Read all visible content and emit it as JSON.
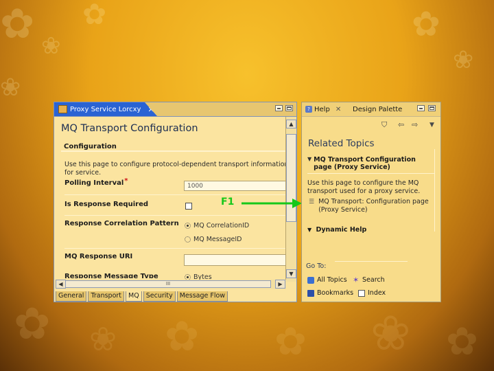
{
  "editor": {
    "tab_label": "Proxy Service Lorcxy",
    "title": "MQ Transport Configuration",
    "section": "Configuration",
    "description": "Use this page to configure protocol-dependent transport information for service.",
    "fields": {
      "polling_label": "Polling Interval",
      "polling_required": "*",
      "polling_value": "1000",
      "response_required_label": "Is Response Required",
      "correlation_label": "Response Correlation Pattern",
      "correlation_options": [
        "MQ CorrelationID",
        "MQ MessageID"
      ],
      "response_uri_label": "MQ Response URI",
      "response_uri_value": "",
      "response_msg_type_label": "Response Message Type",
      "response_msg_type_option": "Bytes"
    },
    "scroll_thumb": "III",
    "bottom_tabs": [
      "General",
      "Transport",
      "MQ",
      "Security",
      "Message Flow"
    ],
    "active_bottom_tab": "MQ"
  },
  "help": {
    "tabs": {
      "help": "Help",
      "palette": "Design Palette"
    },
    "related_topics": "Related Topics",
    "section_title": "MQ Transport Configuration page (Proxy Service)",
    "description": "Use this page to configure the MQ transport used for a proxy service.",
    "link": "MQ Transport: Configuration page (Proxy Service)",
    "dynamic_help": "Dynamic Help",
    "goto_label": "Go To:",
    "goto_items": [
      "All Topics",
      "Search",
      "Bookmarks",
      "Index"
    ]
  },
  "annotation": {
    "key_label": "F1",
    "arrow_color": "#16c81a"
  }
}
